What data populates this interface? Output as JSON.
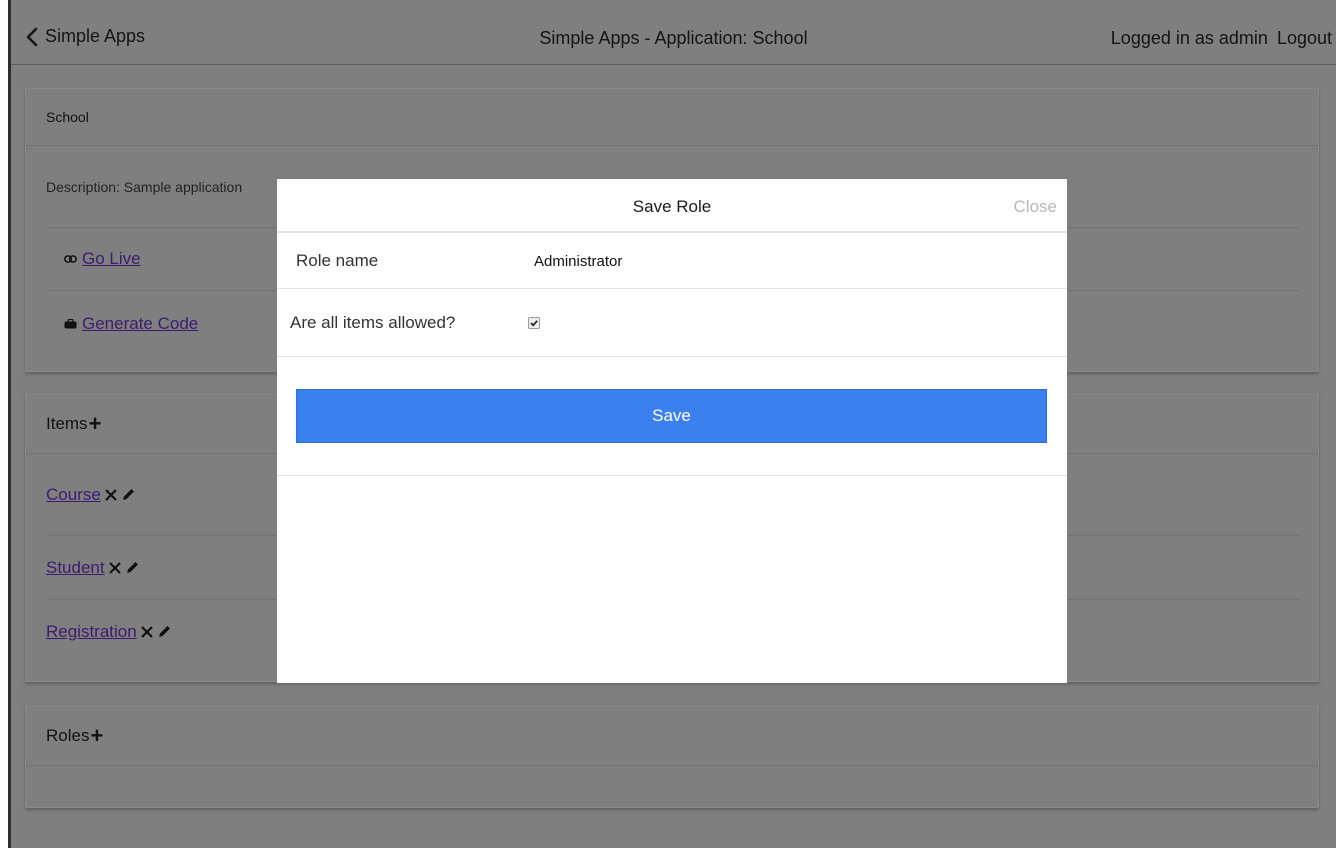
{
  "header": {
    "back_label": "Simple Apps",
    "title": "Simple Apps - Application: School",
    "logged_in_text": "Logged in as admin",
    "logout_label": "Logout"
  },
  "app_panel": {
    "title": "School",
    "description": "Description: Sample application",
    "go_live_label": "Go Live",
    "go_live_icon": "link-icon",
    "generate_code_label": "Generate Code",
    "generate_code_icon": "briefcase-icon"
  },
  "items_panel": {
    "title": "Items",
    "add_icon": "plus-icon",
    "items": [
      {
        "label": "Course"
      },
      {
        "label": "Student"
      },
      {
        "label": "Registration"
      }
    ],
    "item_action_icons": [
      "close-icon",
      "pencil-icon"
    ]
  },
  "roles_panel": {
    "title": "Roles",
    "add_icon": "plus-icon"
  },
  "modal": {
    "title": "Save Role",
    "close_label": "Close",
    "role_name_label": "Role name",
    "role_name_value": "Administrator",
    "all_items_label": "Are all items allowed?",
    "all_items_checked": true,
    "save_label": "Save"
  },
  "colors": {
    "overlay_background": "#7f7f7f",
    "modal_background": "#ffffff",
    "save_button": "#3a80ee",
    "link": "#3b1c6e",
    "close_text": "#b8b8b8"
  }
}
